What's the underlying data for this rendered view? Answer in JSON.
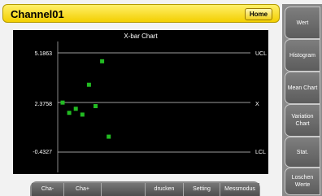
{
  "header": {
    "title": "Channel01",
    "home_label": "Home"
  },
  "chart": {
    "title": "X-bar Chart",
    "y_labels": {
      "top": "5.1863",
      "mid": "2.3758",
      "bottom": "-0.4327"
    },
    "line_labels": {
      "ucl": "UCL",
      "center": "X",
      "lcl": "LCL"
    }
  },
  "sidebar": {
    "items": [
      {
        "label": "Wert"
      },
      {
        "label": "Histogram"
      },
      {
        "label": "Mean Chart"
      },
      {
        "label": "Variation Chart"
      },
      {
        "label": "Stat."
      },
      {
        "label": "Loschen Werte"
      }
    ]
  },
  "bottom": {
    "items": [
      {
        "label": "Cha-"
      },
      {
        "label": "Cha+"
      },
      {
        "label": ""
      },
      {
        "label": "drucken"
      },
      {
        "label": "Setting"
      },
      {
        "label": "Messmodus"
      }
    ]
  },
  "colors": {
    "header_yellow": "#f5d800",
    "point_green": "#22bb22",
    "chart_bg": "#000000"
  },
  "chart_data": {
    "type": "scatter",
    "title": "X-bar Chart",
    "ucl": 5.1863,
    "center": 2.3758,
    "lcl": -0.4327,
    "ylim": [
      -0.4327,
      5.1863
    ],
    "points": [
      {
        "x": 1,
        "y": 2.37
      },
      {
        "x": 2,
        "y": 1.79
      },
      {
        "x": 3,
        "y": 2.02
      },
      {
        "x": 4,
        "y": 1.69
      },
      {
        "x": 5,
        "y": 3.38
      },
      {
        "x": 6,
        "y": 2.17
      },
      {
        "x": 7,
        "y": 4.71
      },
      {
        "x": 8,
        "y": 0.44
      }
    ]
  }
}
